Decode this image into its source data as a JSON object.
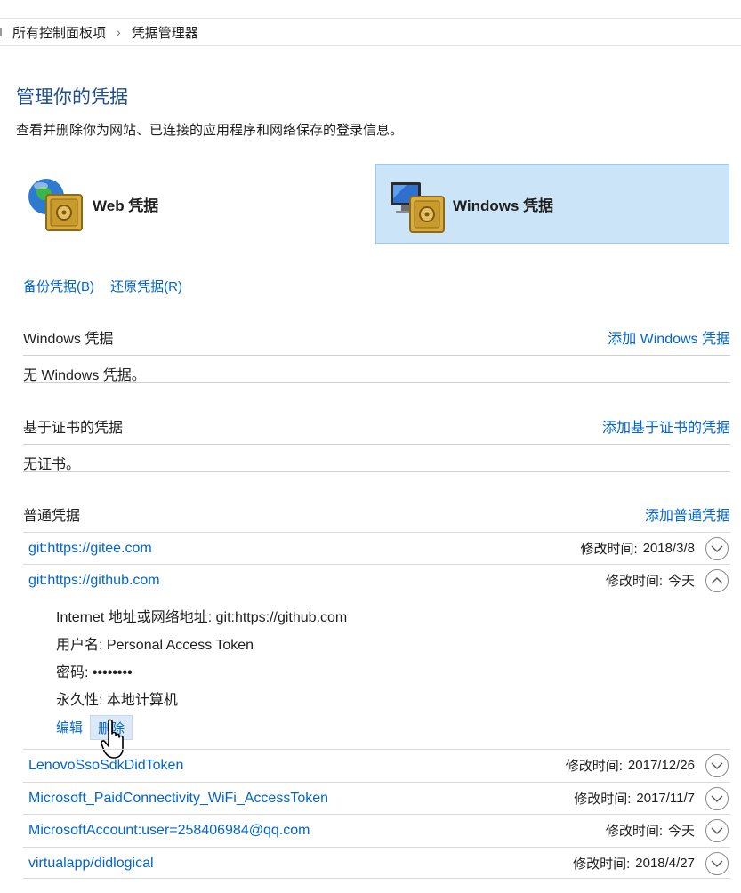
{
  "breadcrumb": {
    "root": "所有控制面板项",
    "separator": "›",
    "current": "凭据管理器"
  },
  "page": {
    "title": "管理你的凭据",
    "description": "查看并删除你为网站、已连接的应用程序和网络保存的登录信息。"
  },
  "credential_types": {
    "web": {
      "label": "Web 凭据",
      "icon": "web-credential-vault-icon"
    },
    "windows": {
      "label": "Windows 凭据",
      "icon": "windows-credential-vault-icon",
      "selected": true
    }
  },
  "links": {
    "backup": "备份凭据(B)",
    "restore": "还原凭据(R)"
  },
  "sections": {
    "windows": {
      "title": "Windows 凭据",
      "add": "添加 Windows 凭据",
      "empty": "无 Windows 凭据。"
    },
    "certificate": {
      "title": "基于证书的凭据",
      "add": "添加基于证书的凭据",
      "empty": "无证书。"
    },
    "generic": {
      "title": "普通凭据",
      "add": "添加普通凭据"
    }
  },
  "modified_label": "修改时间:",
  "generic_credentials": [
    {
      "name": "git:https://gitee.com",
      "modified": "2018/3/8",
      "expanded": false
    },
    {
      "name": "git:https://github.com",
      "modified": "今天",
      "expanded": true
    },
    {
      "name": "LenovoSsoSdkDidToken",
      "modified": "2017/12/26",
      "expanded": false
    },
    {
      "name": "Microsoft_PaidConnectivity_WiFi_AccessToken",
      "modified": "2017/11/7",
      "expanded": false
    },
    {
      "name": "MicrosoftAccount:user=258406984@qq.com",
      "modified": "今天",
      "expanded": false
    },
    {
      "name": "virtualapp/didlogical",
      "modified": "2018/4/27",
      "expanded": false
    }
  ],
  "expanded_detail": {
    "address_label": "Internet 地址或网络地址:",
    "address_value": "git:https://github.com",
    "username_label": "用户名:",
    "username_value": "Personal Access Token",
    "password_label": "密码:",
    "password_value": "••••••••",
    "persistence_label": "永久性:",
    "persistence_value": "本地计算机",
    "edit": "编辑",
    "delete": "删除"
  },
  "colors": {
    "link": "#0066cc",
    "title": "#1e4f8c",
    "selected_bg": "#cce4f7",
    "selected_border": "#99c9ef"
  }
}
